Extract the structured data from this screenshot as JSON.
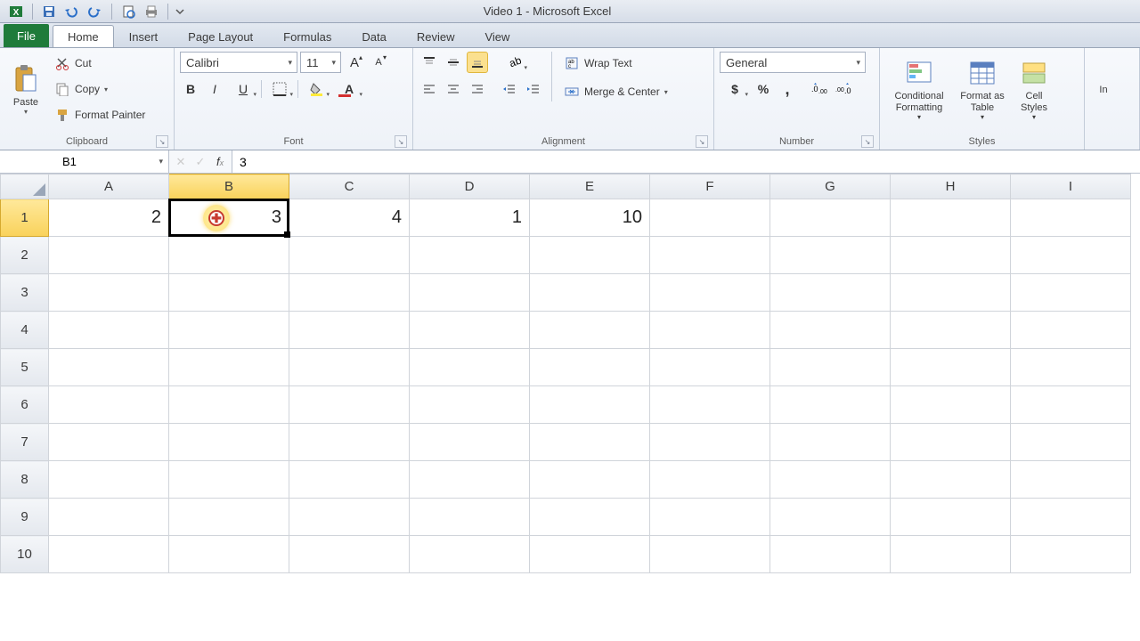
{
  "title": "Video 1 - Microsoft Excel",
  "tabs": {
    "file": "File",
    "home": "Home",
    "insert": "Insert",
    "page_layout": "Page Layout",
    "formulas": "Formulas",
    "data": "Data",
    "review": "Review",
    "view": "View"
  },
  "clipboard": {
    "paste": "Paste",
    "cut": "Cut",
    "copy": "Copy",
    "format_painter": "Format Painter",
    "label": "Clipboard"
  },
  "font": {
    "name": "Calibri",
    "size": "11",
    "label": "Font"
  },
  "alignment": {
    "wrap": "Wrap Text",
    "merge": "Merge & Center",
    "label": "Alignment"
  },
  "number": {
    "format": "General",
    "label": "Number"
  },
  "styles": {
    "conditional": "Conditional Formatting",
    "table": "Format as Table",
    "cell": "Cell Styles",
    "label": "Styles"
  },
  "namebox": "B1",
  "formula": "3",
  "columns": [
    "A",
    "B",
    "C",
    "D",
    "E",
    "F",
    "G",
    "H",
    "I"
  ],
  "rows": [
    "1",
    "2",
    "3",
    "4",
    "5",
    "6",
    "7",
    "8",
    "9",
    "10"
  ],
  "cells": {
    "A1": "2",
    "B1": "3",
    "C1": "4",
    "D1": "1",
    "E1": "10"
  },
  "selected": {
    "col": "B",
    "row": "1"
  }
}
